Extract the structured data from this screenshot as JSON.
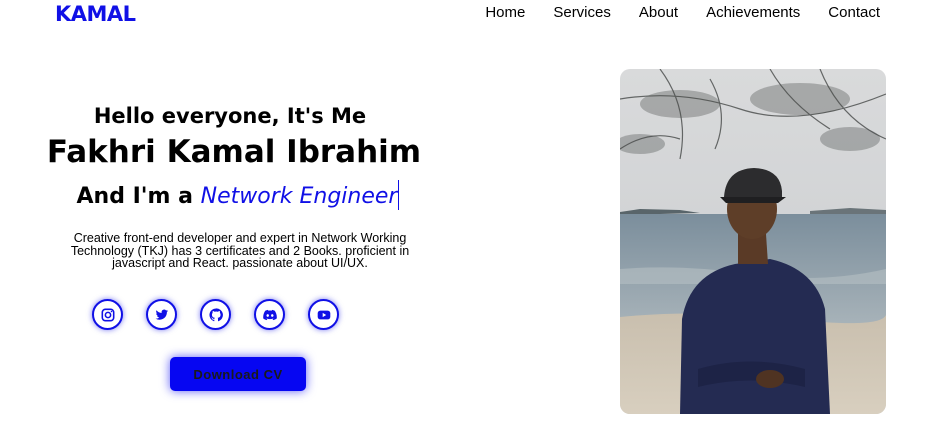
{
  "nav": {
    "logo": "KAMAL",
    "items": [
      "Home",
      "Services",
      "About",
      "Achievements",
      "Contact"
    ]
  },
  "hero": {
    "greeting": "Hello everyone, It's Me",
    "name": "Fakhri Kamal Ibrahim",
    "role_prefix": "And I'm a",
    "role_typed": "Network Engineer",
    "bio": "Creative front-end developer and expert in Network Working Technology (TKJ) has 3 certificates and 2 Books. proficient in javascript and React. passionate about UI/UX.",
    "download_label": "Download CV"
  },
  "socials": [
    {
      "icon": "instagram-icon"
    },
    {
      "icon": "twitter-icon"
    },
    {
      "icon": "github-icon"
    },
    {
      "icon": "discord-icon"
    },
    {
      "icon": "youtube-icon"
    }
  ],
  "colors": {
    "accent": "#1010e6",
    "button": "#0606f2",
    "text": "#000000",
    "background": "#ffffff"
  }
}
